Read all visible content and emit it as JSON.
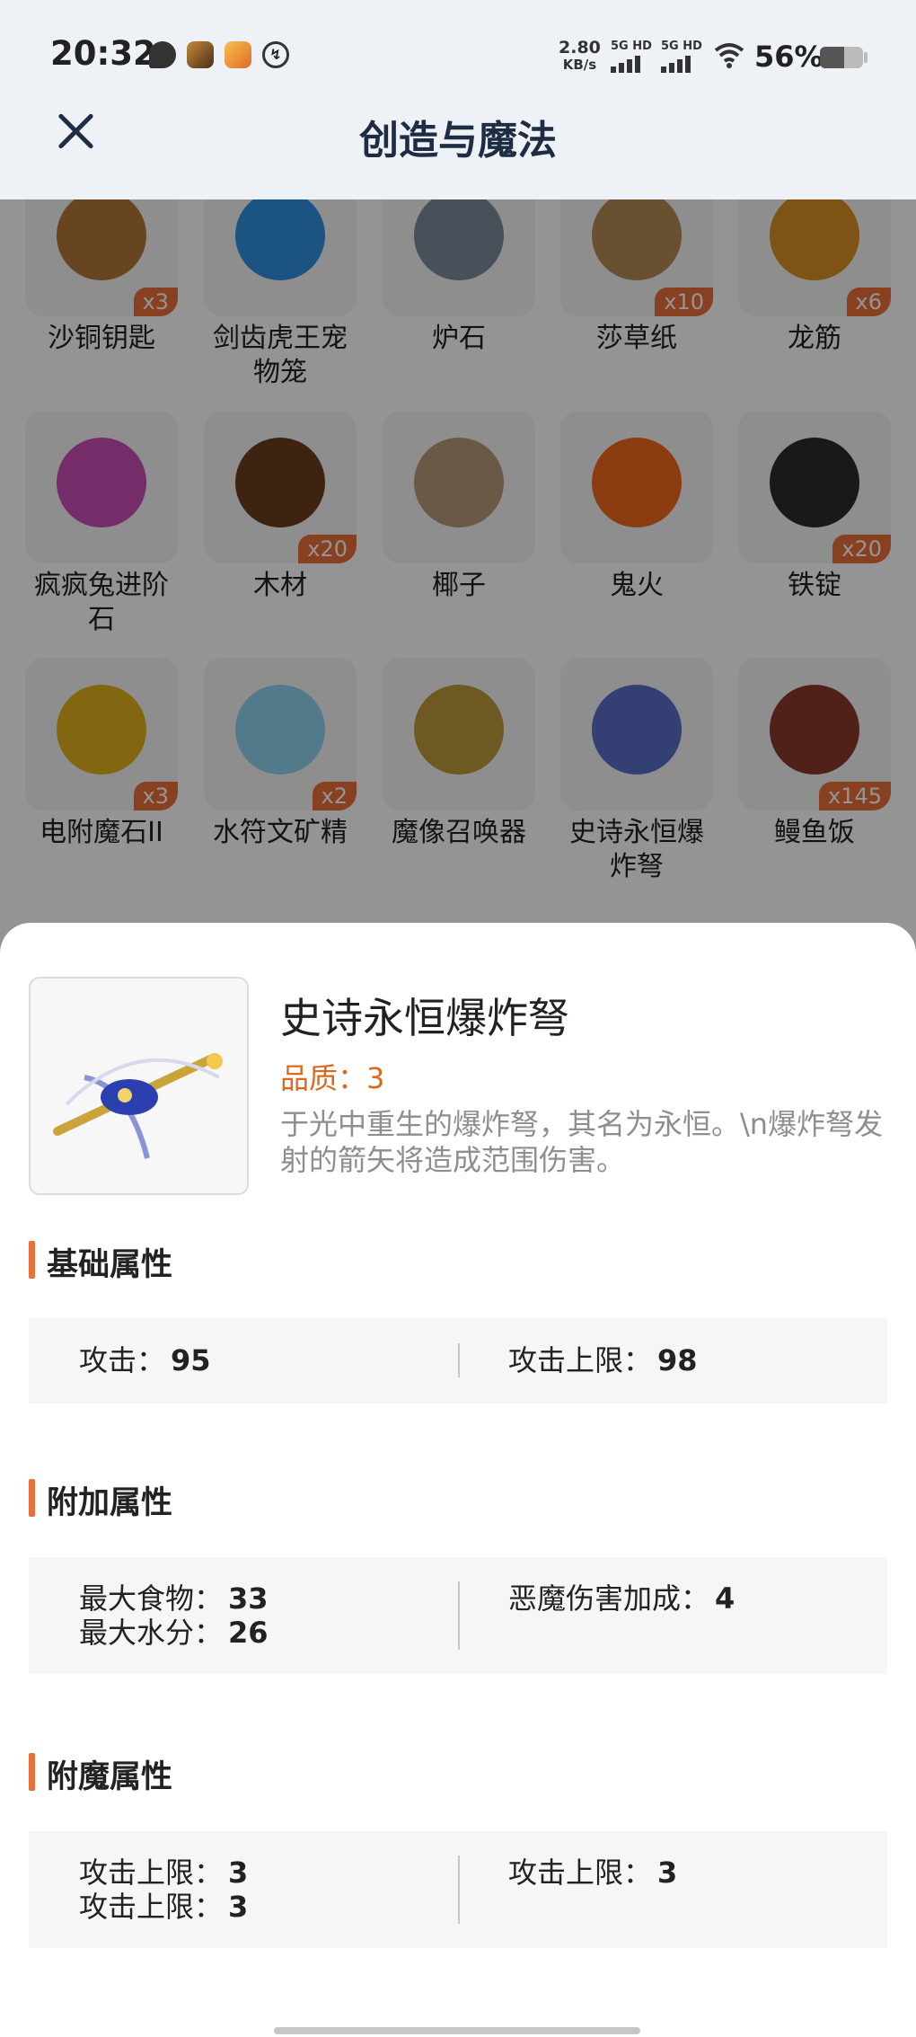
{
  "status_bar": {
    "time": "20:32",
    "net_speed_value": "2.80",
    "net_speed_unit": "KB/s",
    "sim1": "5G HD",
    "sim2": "5G HD",
    "battery": "56%",
    "battery_level": 0.56,
    "icons": [
      "chat-icon",
      "game-app-icon",
      "app-icon",
      "sync-icon",
      "wifi-icon",
      "battery-icon"
    ]
  },
  "header": {
    "title": "创造与魔法"
  },
  "grid": {
    "rows": [
      [
        {
          "name": "沙铜钥匙",
          "qty": "x3",
          "color": "#b2773a"
        },
        {
          "name": "剑齿虎王宠物笼",
          "qty": "",
          "color": "#2f8fe0"
        },
        {
          "name": "炉石",
          "qty": "",
          "color": "#7d8a99"
        },
        {
          "name": "莎草纸",
          "qty": "x10",
          "color": "#b58a55"
        },
        {
          "name": "龙筋",
          "qty": "x6",
          "color": "#d99022"
        }
      ],
      [
        {
          "name": "疯疯兔进阶石",
          "qty": "",
          "color": "#c94fb6"
        },
        {
          "name": "木材",
          "qty": "x20",
          "color": "#6b3d1e"
        },
        {
          "name": "椰子",
          "qty": "",
          "color": "#b79a7a"
        },
        {
          "name": "鬼火",
          "qty": "",
          "color": "#f06a1e"
        },
        {
          "name": "铁锭",
          "qty": "x20",
          "color": "#2b2b2b"
        }
      ],
      [
        {
          "name": "电附魔石II",
          "qty": "x3",
          "color": "#e1b21c"
        },
        {
          "name": "水符文矿精",
          "qty": "x2",
          "color": "#8fd2ef"
        },
        {
          "name": "魔像召唤器",
          "qty": "",
          "color": "#c09a3c"
        },
        {
          "name": "史诗永恒爆炸弩",
          "qty": "",
          "color": "#5a6fc8"
        },
        {
          "name": "鳗鱼饭",
          "qty": "x145",
          "color": "#8a3a2a"
        }
      ]
    ]
  },
  "detail": {
    "name": "史诗永恒爆炸弩",
    "quality": "品质：3",
    "description": "于光中重生的爆炸弩，其名为永恒。\\n爆炸弩发射的箭矢将造成范围伤害。",
    "sections": {
      "basic": {
        "title": "基础属性",
        "left": [
          {
            "label": "攻击：",
            "value": "95"
          }
        ],
        "right": [
          {
            "label": "攻击上限：",
            "value": "98"
          }
        ]
      },
      "extra": {
        "title": "附加属性",
        "left": [
          {
            "label": "最大食物：",
            "value": "33"
          },
          {
            "label": "最大水分：",
            "value": "26"
          }
        ],
        "right": [
          {
            "label": "恶魔伤害加成：",
            "value": "4"
          }
        ]
      },
      "enchant": {
        "title": "附魔属性",
        "left": [
          {
            "label": "攻击上限：",
            "value": "3"
          },
          {
            "label": "攻击上限：",
            "value": "3"
          }
        ],
        "right": [
          {
            "label": "攻击上限：",
            "value": "3"
          }
        ]
      }
    }
  },
  "colors": {
    "accent": "#e8703a",
    "quality": "#d96a1d",
    "title": "#1f2d44"
  }
}
